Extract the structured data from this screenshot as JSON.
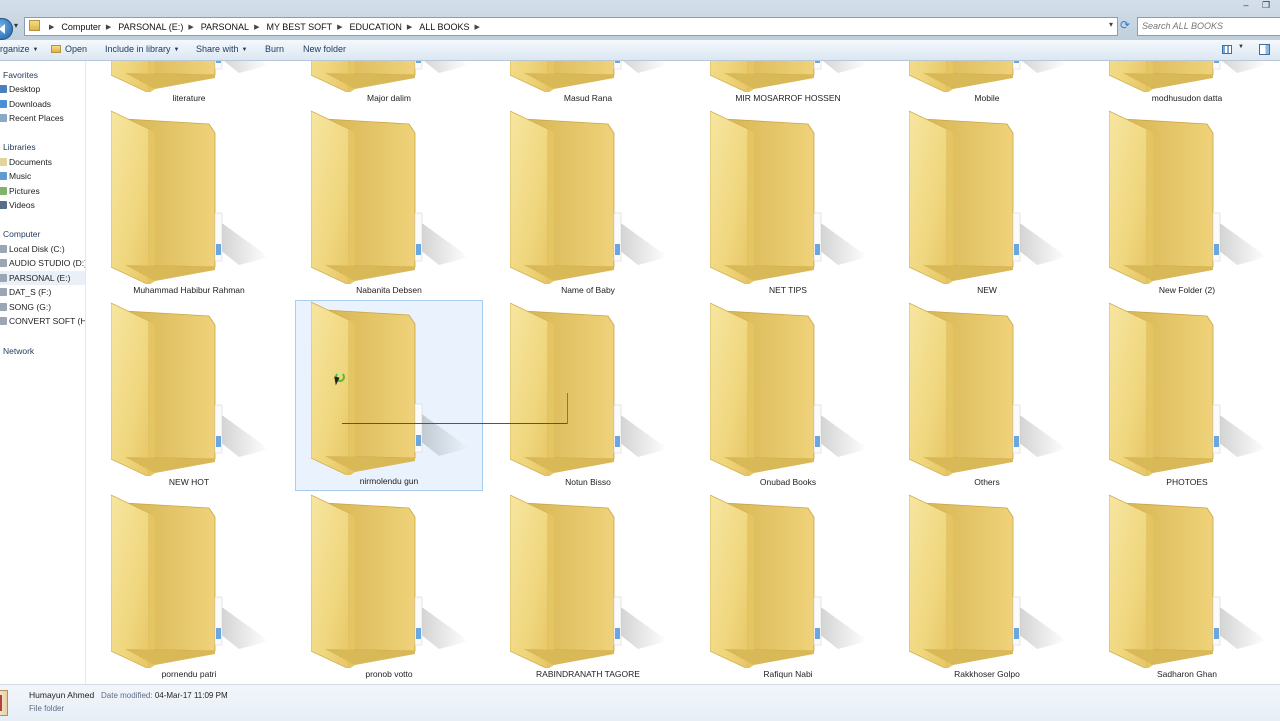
{
  "address_bar": {
    "crumbs": [
      "Computer",
      "PARSONAL (E:)",
      "PARSONAL",
      "MY BEST SOFT",
      "EDUCATION",
      "ALL BOOKS"
    ],
    "search_placeholder": "Search ALL BOOKS"
  },
  "toolbar": {
    "organize": "rganize",
    "open": "Open",
    "include_in_library": "Include in library",
    "share_with": "Share with",
    "burn": "Burn",
    "new_folder": "New folder"
  },
  "nav": {
    "favorites": "Favorites",
    "desktop": "Desktop",
    "downloads": "Downloads",
    "recent_places": "Recent Places",
    "libraries": "Libraries",
    "documents": "Documents",
    "music": "Music",
    "pictures": "Pictures",
    "videos": "Videos",
    "computer": "Computer",
    "local_disk": "Local Disk (C:)",
    "audio_studio": "AUDIO STUDIO (D:)",
    "parsonal": "PARSONAL (E:)",
    "dat_s": "DAT_S (F:)",
    "song": "SONG (G:)",
    "convert_soft": "CONVERT SOFT (H:)",
    "network": "Network"
  },
  "folders": {
    "row0": [
      "literature",
      "Major dalim",
      "Masud Rana",
      "MIR MOSARROF HOSSEN",
      "Mobile",
      "modhusudon datta"
    ],
    "row1": [
      "Muhammad Habibur Rahman",
      "Nabanita Debsen",
      "Name of Baby",
      "NET TIPS",
      "NEW",
      "New Folder (2)"
    ],
    "row2": [
      "NEW HOT",
      "nirmolendu gun",
      "Notun Bisso",
      "Onubad Books",
      "Others",
      "PHOTOES"
    ],
    "row3": [
      "pornendu patri",
      "pronob votto",
      "RABINDRANATH TAGORE",
      "Rafiqun Nabi",
      "Rakkhoser Golpo",
      "Sadharon Ghan"
    ]
  },
  "selected_folder": "nirmolendu gun",
  "details": {
    "name": "Humayun Ahmed",
    "date_modified_label": "Date modified:",
    "date_modified": "04-Mar-17 11:09 PM",
    "type": "File folder"
  },
  "colors": {
    "folder_front": "#f3dc86",
    "folder_back": "#e2c262",
    "selection_bg": "#eaf3fd",
    "selection_border": "#a9cdee",
    "nav_text": "#1e395b"
  },
  "icons": {
    "back": "back-arrow-icon",
    "refresh": "refresh-icon",
    "folder": "folder-icon",
    "cursor": "busy-cursor-icon"
  }
}
